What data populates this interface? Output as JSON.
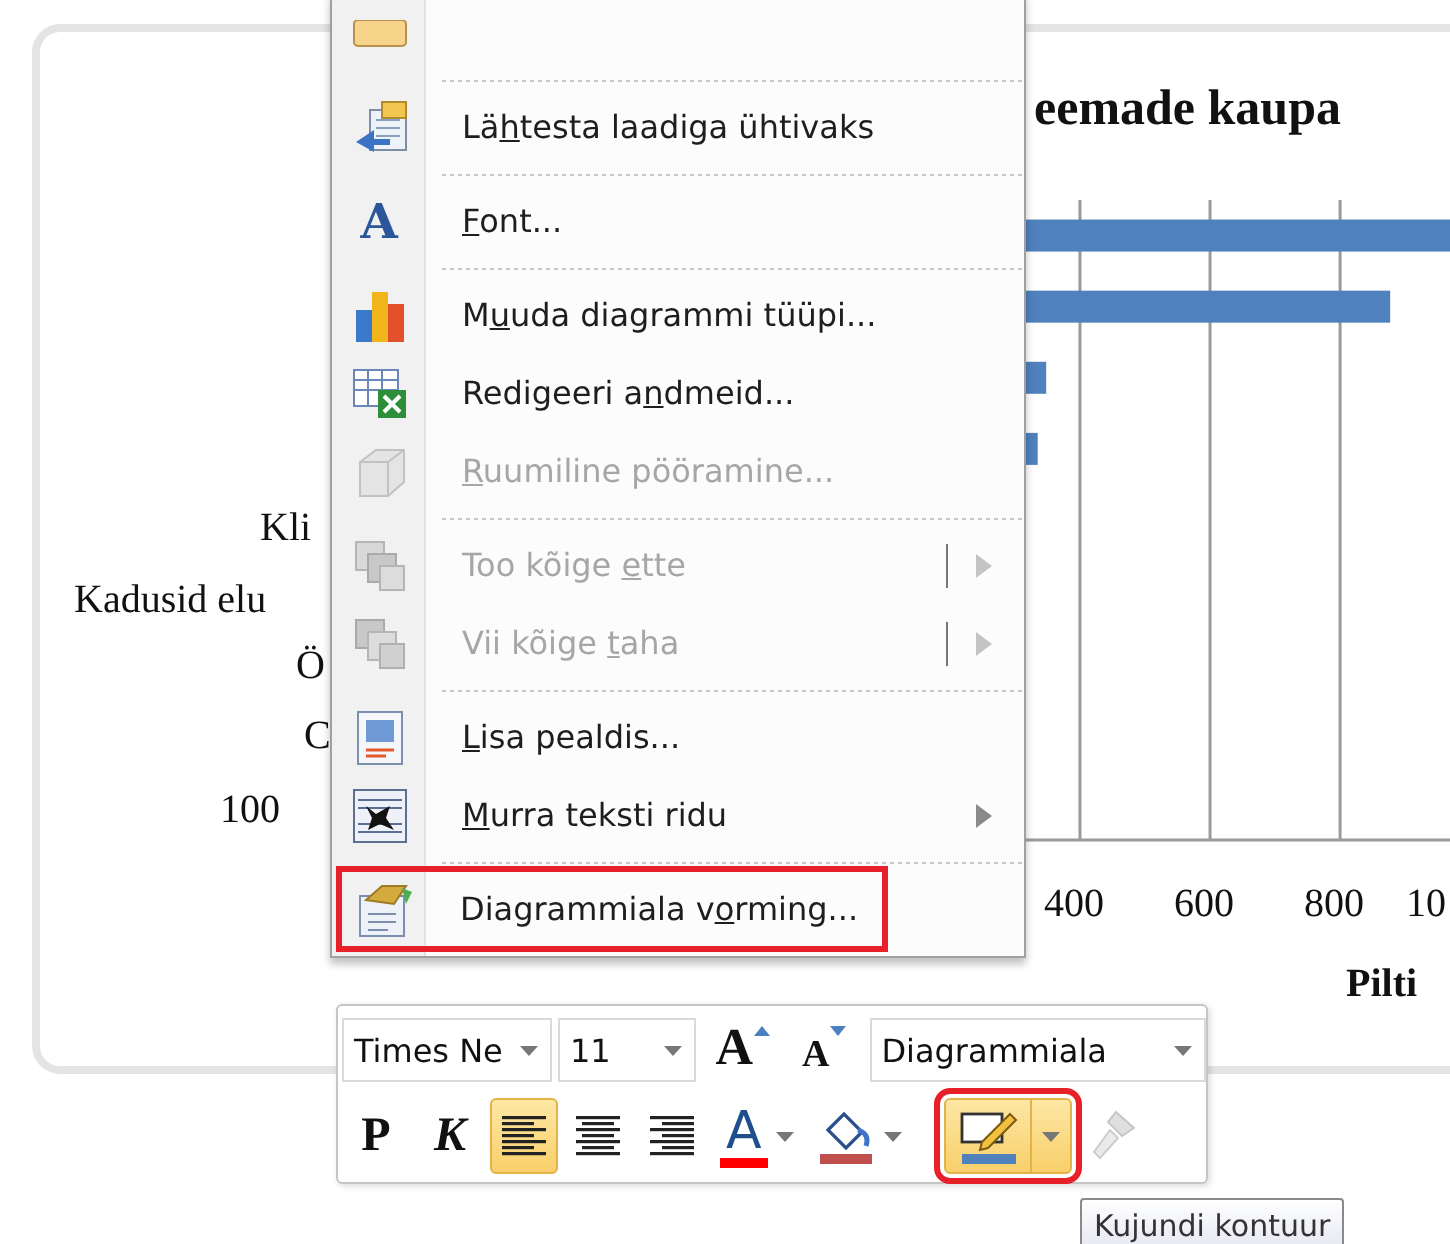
{
  "chart": {
    "category_labels": [
      "Kli",
      "Kadusid elu",
      "Ö",
      "C",
      "100"
    ],
    "cut_tick_label": "10",
    "chart_data": {
      "type": "bar",
      "orientation": "horizontal",
      "title": "eemade kaupa",
      "xlabel": "Pilti",
      "values": [
        969,
        877,
        348,
        335,
        null,
        null,
        null,
        null,
        null
      ],
      "xlim": [
        317,
        969
      ],
      "xticks": [
        400,
        600,
        800
      ],
      "grid": true
    }
  },
  "context_menu": {
    "items": [
      {
        "kind": "item"
      },
      {
        "kind": "separator"
      },
      {
        "kind": "item",
        "label": {
          "pre": "Lä",
          "key": "h",
          "post": "testa laadiga ühtivaks"
        },
        "disabled": false,
        "submenu": false,
        "split": false,
        "highlighted": false
      },
      {
        "kind": "separator"
      },
      {
        "kind": "item",
        "glyph": "A",
        "label": {
          "key": "F",
          "post": "ont..."
        },
        "disabled": false,
        "submenu": false,
        "split": false,
        "highlighted": false
      },
      {
        "kind": "separator"
      },
      {
        "kind": "item",
        "label": {
          "pre": "M",
          "key": "u",
          "post": "uda diagrammi tüüpi..."
        },
        "disabled": false,
        "submenu": false,
        "split": false,
        "highlighted": false
      },
      {
        "kind": "item",
        "label": {
          "pre": "Redigeeri a",
          "key": "n",
          "post": "dmeid..."
        },
        "disabled": false,
        "submenu": false,
        "split": false,
        "highlighted": false
      },
      {
        "kind": "item",
        "label": {
          "key": "R",
          "post": "uumiline pööramine..."
        },
        "disabled": true,
        "submenu": false,
        "split": false,
        "highlighted": false
      },
      {
        "kind": "separator"
      },
      {
        "kind": "item",
        "label": {
          "pre": "Too kõige ",
          "key": "e",
          "post": "tte"
        },
        "disabled": true,
        "submenu": true,
        "split": true,
        "highlighted": false
      },
      {
        "kind": "item",
        "label": {
          "pre": "Vii kõige ",
          "key": "t",
          "post": "aha"
        },
        "disabled": true,
        "submenu": true,
        "split": true,
        "highlighted": false
      },
      {
        "kind": "separator"
      },
      {
        "kind": "item",
        "label": {
          "key": "L",
          "post": "isa pealdis..."
        },
        "disabled": false,
        "submenu": false,
        "split": false,
        "highlighted": false
      },
      {
        "kind": "item",
        "label": {
          "key": "M",
          "post": "urra teksti ridu"
        },
        "disabled": false,
        "submenu": true,
        "split": false,
        "highlighted": false
      },
      {
        "kind": "separator"
      },
      {
        "kind": "item",
        "label": {
          "pre": "Diagrammiala v",
          "key": "o",
          "post": "rming..."
        },
        "disabled": false,
        "submenu": false,
        "split": false,
        "highlighted": true
      }
    ]
  },
  "mini_toolbar": {
    "font_name": "Times Ne",
    "font_size": "11",
    "grow_font": {
      "glyph": "A"
    },
    "shrink_font": {
      "glyph": "A"
    },
    "element": "Diagrammiala",
    "buttons": [
      {
        "kind": "bold",
        "label": "P",
        "selected": false,
        "highlighted": false,
        "disabled": false
      },
      {
        "kind": "italic",
        "label": "K",
        "selected": false,
        "highlighted": false,
        "disabled": false
      },
      {
        "kind": "align-left",
        "selected": true,
        "highlighted": false,
        "disabled": false
      },
      {
        "kind": "align-center",
        "selected": false,
        "highlighted": false,
        "disabled": false
      },
      {
        "kind": "align-right",
        "selected": false,
        "highlighted": false,
        "disabled": false
      },
      {
        "kind": "font-color",
        "glyph": "A",
        "selected": false,
        "highlighted": false,
        "disabled": false
      },
      {
        "kind": "fill",
        "selected": false,
        "highlighted": false,
        "disabled": false
      },
      {
        "kind": "outline",
        "selected": true,
        "highlighted": true,
        "disabled": false
      },
      {
        "kind": "painter",
        "selected": false,
        "highlighted": false,
        "disabled": true
      }
    ]
  },
  "tooltip": "Kujundi kontuur"
}
